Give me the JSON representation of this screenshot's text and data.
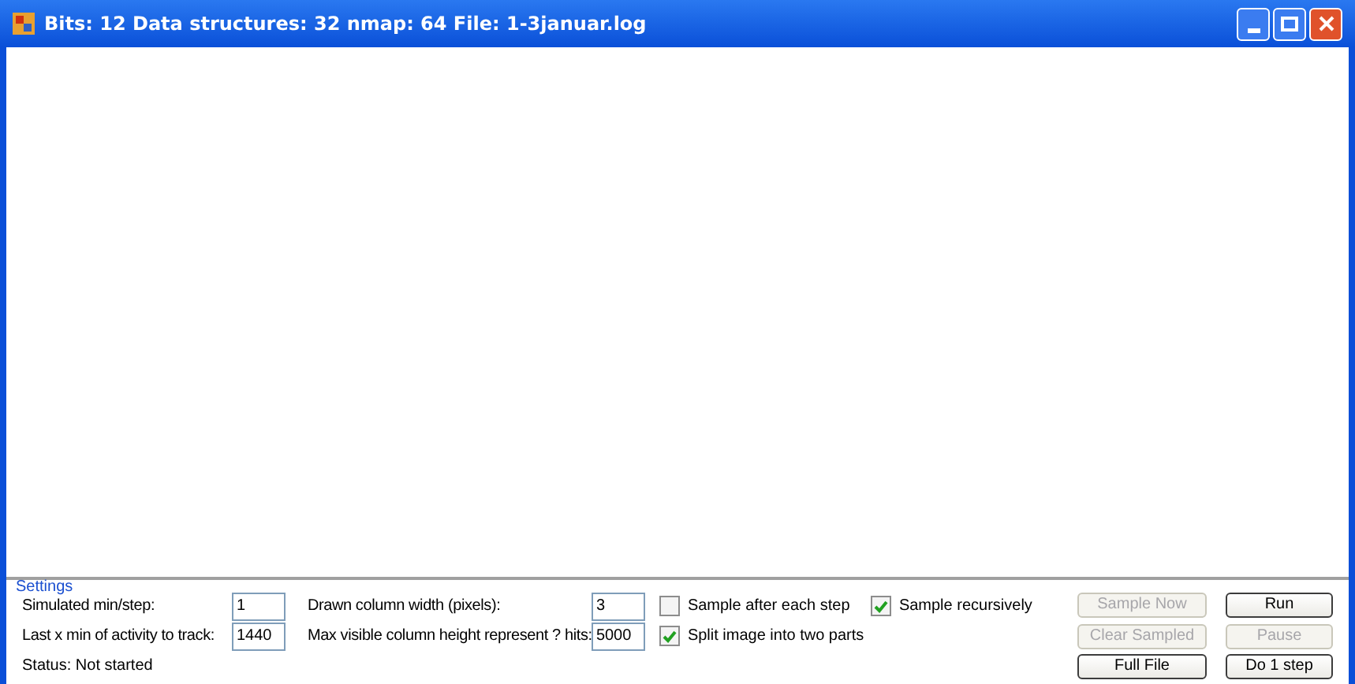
{
  "window": {
    "title": "Bits: 12 Data structures: 32 nmap: 64 File: 1-3januar.log"
  },
  "settings": {
    "legend": "Settings",
    "fields": [
      {
        "label": "Simulated min/step:",
        "value": "1"
      },
      {
        "label": "Last x min of activity to track:",
        "value": "1440"
      },
      {
        "label": "Drawn column width (pixels):",
        "value": "3"
      },
      {
        "label": "Max visible column height represent ? hits:",
        "value": "5000"
      }
    ],
    "checkboxes": [
      {
        "label": "Sample after each step",
        "checked": false
      },
      {
        "label": "Split image into two parts",
        "checked": true
      },
      {
        "label": "Sample recursively",
        "checked": true
      }
    ],
    "buttons": [
      {
        "label": "Sample Now",
        "disabled": true
      },
      {
        "label": "Run",
        "disabled": false
      },
      {
        "label": "Clear Sampled",
        "disabled": true
      },
      {
        "label": "Pause",
        "disabled": true
      },
      {
        "label": "Full File",
        "disabled": false
      },
      {
        "label": "Do 1 step",
        "disabled": false
      }
    ],
    "status": "Status: Not started"
  }
}
